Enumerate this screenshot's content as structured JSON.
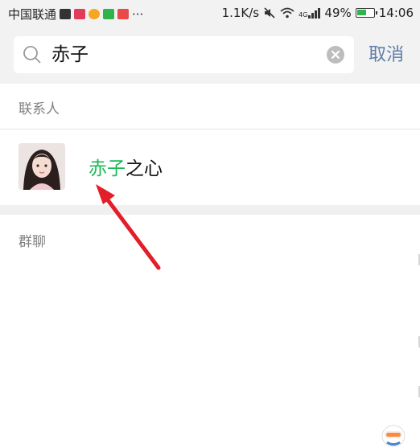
{
  "status_bar": {
    "carrier": "中国联通",
    "network_speed": "1.1K/s",
    "network_type": "4G",
    "battery": "49%",
    "time": "14:06",
    "more": "···"
  },
  "search": {
    "query": "赤子",
    "cancel_label": "取消"
  },
  "sections": {
    "contacts_title": "联系人",
    "groups_title": "群聊"
  },
  "contact": {
    "name_highlight": "赤子",
    "name_rest": "之心"
  },
  "colors": {
    "highlight": "#19b955",
    "cancel": "#5f7ea7",
    "arrow": "#e21e2a"
  }
}
